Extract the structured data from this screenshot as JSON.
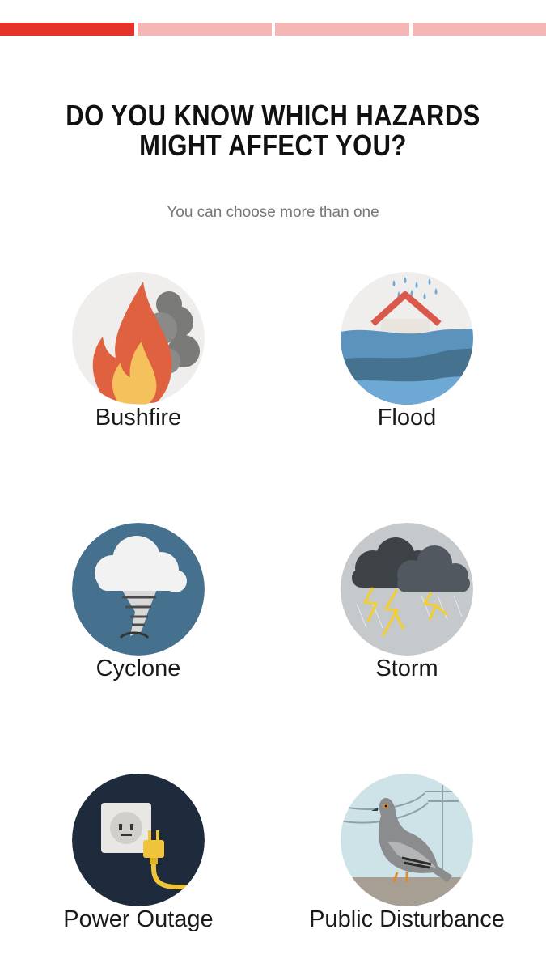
{
  "progress": {
    "total_steps": 4,
    "current_step": 1,
    "active_color": "#e63329",
    "inactive_color": "#f4b7b6"
  },
  "question": {
    "title_line1": "DO YOU KNOW WHICH HAZARDS",
    "title_line2": "MIGHT AFFECT YOU?",
    "subtitle": "You can choose more than one"
  },
  "hazards": [
    {
      "label": "Bushfire",
      "icon": "fire-icon"
    },
    {
      "label": "Flood",
      "icon": "flooded-house-icon"
    },
    {
      "label": "Cyclone",
      "icon": "tornado-cloud-icon"
    },
    {
      "label": "Storm",
      "icon": "storm-cloud-lightning-icon"
    },
    {
      "label": "Power Outage",
      "icon": "power-plug-outlet-icon"
    },
    {
      "label": "Public Disturbance",
      "icon": "pigeon-icon"
    }
  ]
}
